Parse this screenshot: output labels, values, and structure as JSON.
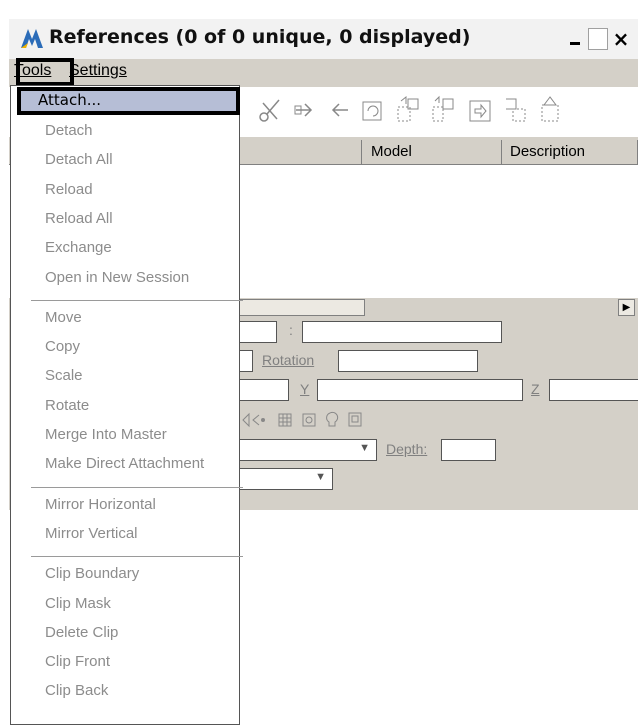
{
  "window": {
    "title": "References (0 of 0 unique, 0 displayed)",
    "minimize_label": "",
    "close_label": "×"
  },
  "menubar": {
    "tools": "Tools",
    "settings": "Settings"
  },
  "list": {
    "columns": [
      "Model",
      "Description"
    ]
  },
  "props": {
    "rotation_label": "Rotation",
    "y_label": "Y",
    "z_label": "Z",
    "colon": ":",
    "depth_label": "Depth:"
  },
  "tools_menu": {
    "attach": "Attach...",
    "groups": [
      [
        "Detach",
        "Detach All",
        "Reload",
        "Reload All",
        "Exchange",
        "Open in New Session"
      ],
      [
        "Move",
        "Copy",
        "Scale",
        "Rotate",
        "Merge Into Master",
        "Make Direct Attachment"
      ],
      [
        "Mirror Horizontal",
        "Mirror Vertical"
      ],
      [
        "Clip Boundary",
        "Clip Mask",
        "Delete Clip",
        "Clip Front",
        "Clip Back"
      ]
    ]
  },
  "colors": {
    "menu_highlight": "#b6bed6",
    "disabled_text": "#8c8c8c",
    "window_bg": "#d4d0c8"
  }
}
